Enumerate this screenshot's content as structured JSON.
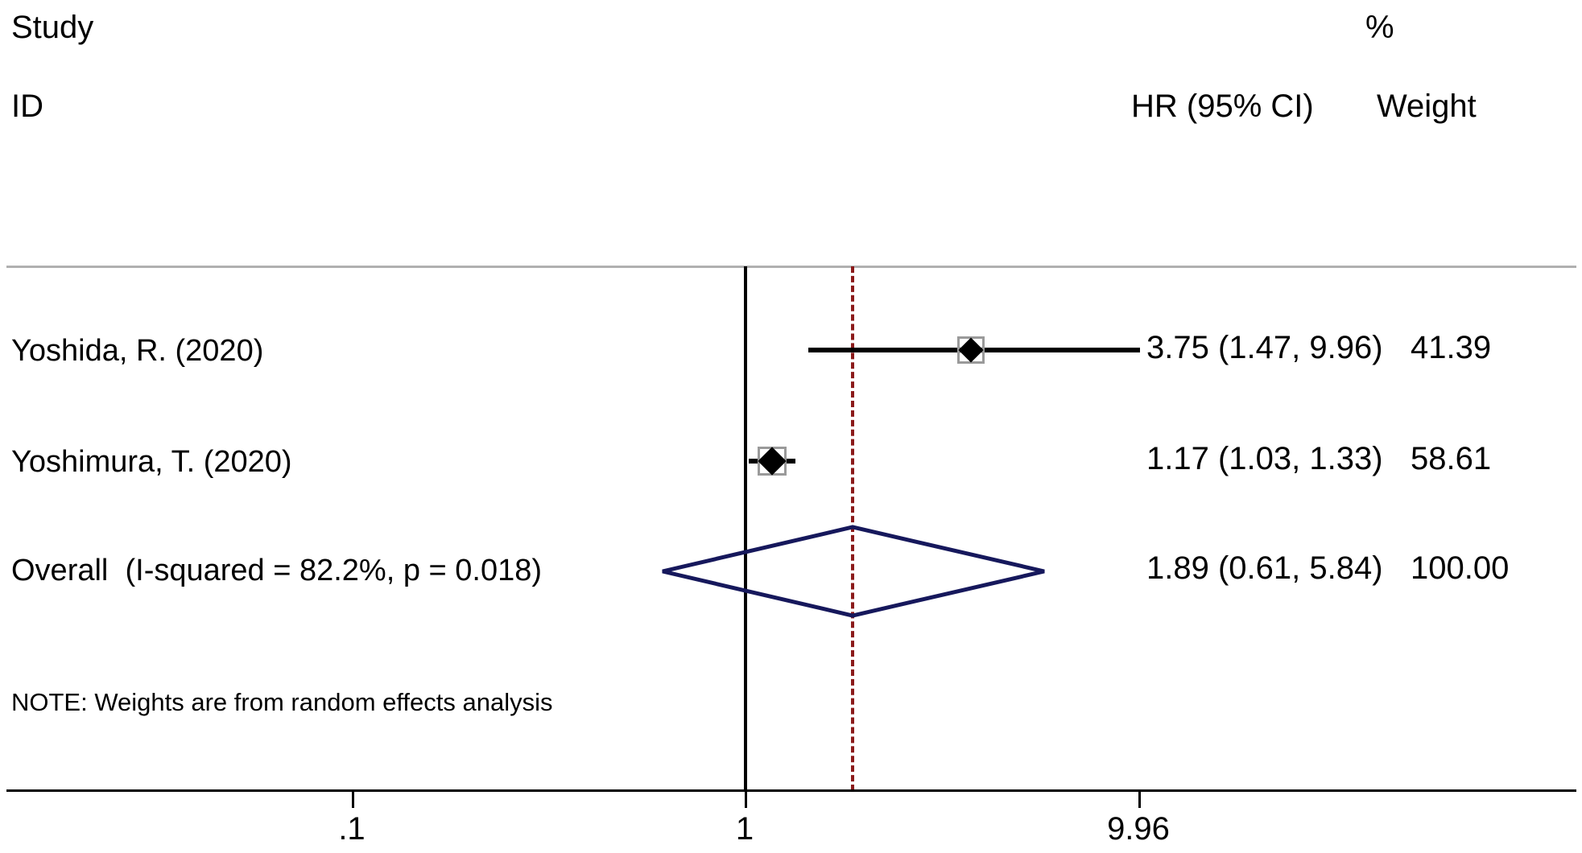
{
  "header": {
    "col_study_line1": "Study",
    "col_study_line2": "ID",
    "col_pct": "%",
    "col_effect": "HR (95% CI)",
    "col_weight": "Weight"
  },
  "note": "NOTE: Weights are from random effects analysis",
  "axis": {
    "ticks": [
      {
        "label": ".1",
        "value": 0.1
      },
      {
        "label": "1",
        "value": 1
      },
      {
        "label": "9.96",
        "value": 9.96
      }
    ]
  },
  "reference_lines": {
    "null_value": 1,
    "pooled_value": 1.89,
    "null_color": "#000000",
    "pooled_color": "#8b1a1a"
  },
  "rows": [
    {
      "label": "Yoshida, R. (2020)",
      "effect_text": "3.75 (1.47, 9.96)",
      "weight_text": "41.39",
      "est": 3.75,
      "lcl": 1.47,
      "ucl": 9.96,
      "weight": 41.39
    },
    {
      "label": "Yoshimura, T. (2020)",
      "effect_text": "1.17 (1.03, 1.33)",
      "weight_text": "58.61",
      "est": 1.17,
      "lcl": 1.03,
      "ucl": 1.33,
      "weight": 58.61
    }
  ],
  "overall": {
    "label": "Overall  (I-squared = 82.2%, p = 0.018)",
    "effect_text": "1.89 (0.61, 5.84)",
    "weight_text": "100.00",
    "est": 1.89,
    "lcl": 0.61,
    "ucl": 5.84,
    "weight": 100.0,
    "i_squared": "82.2%",
    "p_value": "0.018",
    "color": "#16185c"
  },
  "chart_data": {
    "type": "forest",
    "title": "",
    "xlabel": "",
    "ylabel": "",
    "x_scale": "log",
    "xlim": [
      0.1,
      9.96
    ],
    "effect_measure": "HR (95% CI)",
    "null_line": 1,
    "pooled_line": 1.89,
    "grid": false,
    "legend": "none",
    "categories": [
      "Yoshida, R. (2020)",
      "Yoshimura, T. (2020)",
      "Overall  (I-squared = 82.2%, p = 0.018)"
    ],
    "series": [
      {
        "name": "HR",
        "values": [
          3.75,
          1.17,
          1.89
        ],
        "lower": [
          1.47,
          1.03,
          0.61
        ],
        "upper": [
          9.96,
          1.33,
          5.84
        ],
        "weights": [
          41.39,
          58.61,
          100.0
        ]
      }
    ],
    "annotations": [
      "NOTE: Weights are from random effects analysis",
      "I-squared = 82.2%",
      "p = 0.018"
    ],
    "tick_labels": [
      ".1",
      "1",
      "9.96"
    ]
  }
}
